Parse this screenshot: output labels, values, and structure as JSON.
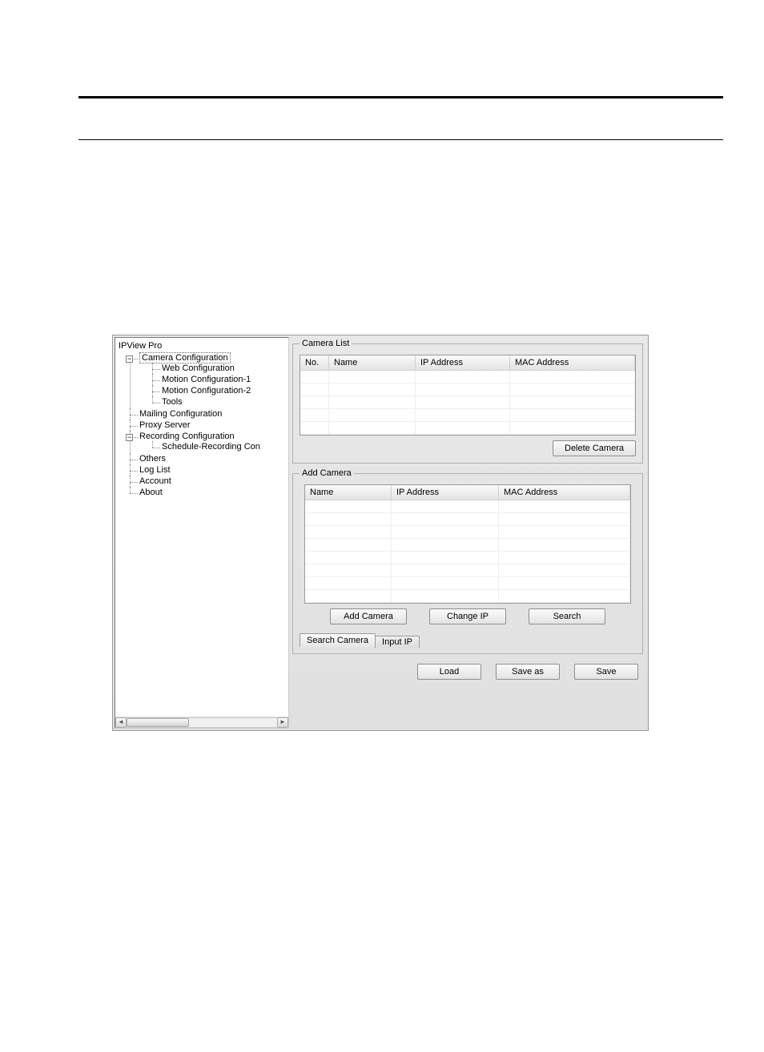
{
  "tree": {
    "root": "IPView Pro",
    "camera_config": "Camera Configuration",
    "web_config": "Web Configuration",
    "motion1": "Motion Configuration-1",
    "motion2": "Motion Configuration-2",
    "tools": "Tools",
    "mailing": "Mailing Configuration",
    "proxy": "Proxy Server",
    "recording": "Recording Configuration",
    "sched_rec": "Schedule-Recording Con",
    "others": "Others",
    "loglist": "Log List",
    "account": "Account",
    "about": "About"
  },
  "camera_list": {
    "legend": "Camera List",
    "col_no": "No.",
    "col_name": "Name",
    "col_ip": "IP Address",
    "col_mac": "MAC Address",
    "delete_btn": "Delete Camera"
  },
  "add_camera": {
    "legend": "Add Camera",
    "col_name": "Name",
    "col_ip": "IP Address",
    "col_mac": "MAC Address",
    "add_btn": "Add Camera",
    "change_ip_btn": "Change IP",
    "search_btn": "Search",
    "tab_search": "Search Camera",
    "tab_input": "Input IP"
  },
  "footer": {
    "load": "Load",
    "saveas": "Save as",
    "save": "Save"
  },
  "expanders": {
    "minus": "−"
  }
}
